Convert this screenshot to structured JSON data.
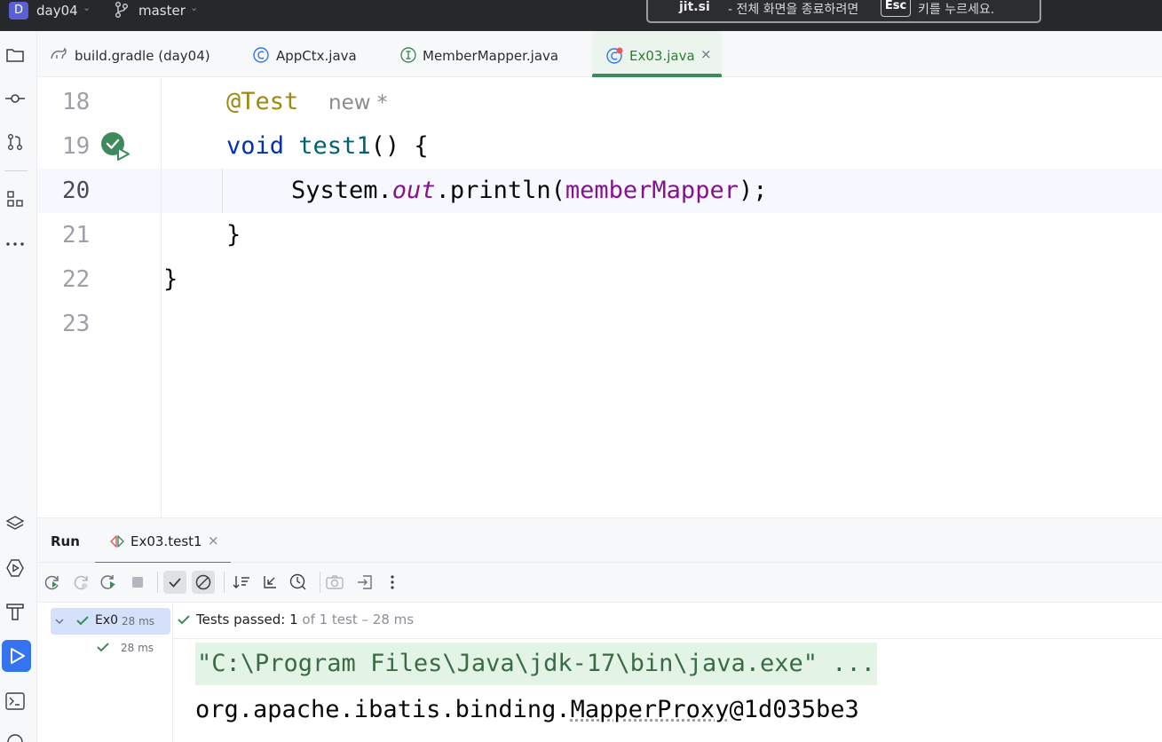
{
  "topbar": {
    "project_badge": "D",
    "project_name": "day04",
    "branch_name": "master",
    "notice": {
      "site": "jit.si",
      "text_before": "- 전체 화면을 종료하려면",
      "key": "Esc",
      "text_after": "키를 누르세요."
    }
  },
  "tabs": [
    {
      "label": "build.gradle (day04)",
      "icon": "gradle-icon"
    },
    {
      "label": "AppCtx.java",
      "icon": "class-icon"
    },
    {
      "label": "MemberMapper.java",
      "icon": "interface-icon"
    },
    {
      "label": "Ex03.java",
      "icon": "test-class-icon",
      "active": true,
      "close": "×"
    }
  ],
  "editor": {
    "line_numbers": [
      "18",
      "19",
      "20",
      "21",
      "22",
      "23"
    ],
    "current_line": "20",
    "code": {
      "l18_annotation": "@Test",
      "l18_hint": "new *",
      "l19_kw": "void",
      "l19_fn": "test1",
      "l19_rest": "() {",
      "l20_a": "System.",
      "l20_field": "out",
      "l20_b": ".println(",
      "l20_var": "memberMapper",
      "l20_c": ");",
      "l21": "}",
      "l22": "}"
    }
  },
  "run_panel": {
    "title": "Run",
    "tab_label": "Ex03.test1",
    "tab_close": "×",
    "tree": {
      "root_label": "Ex0",
      "root_time": "28 ms",
      "child_time": "28 ms"
    },
    "status": {
      "prefix": "Tests passed:",
      "count": "1",
      "suffix": "of 1 test – 28 ms"
    },
    "console": {
      "cmd": "\"C:\\Program Files\\Java\\jdk-17\\bin\\java.exe\" ...",
      "out_prefix": "org.apache.ibatis.binding.",
      "out_class": "MapperProxy",
      "out_suffix": "@1d035be3"
    }
  },
  "colors": {
    "accent": "#3574f0",
    "pass_green": "#3d8a5a",
    "keyword": "#0033b3",
    "annotation": "#9e880d",
    "field": "#871094"
  }
}
